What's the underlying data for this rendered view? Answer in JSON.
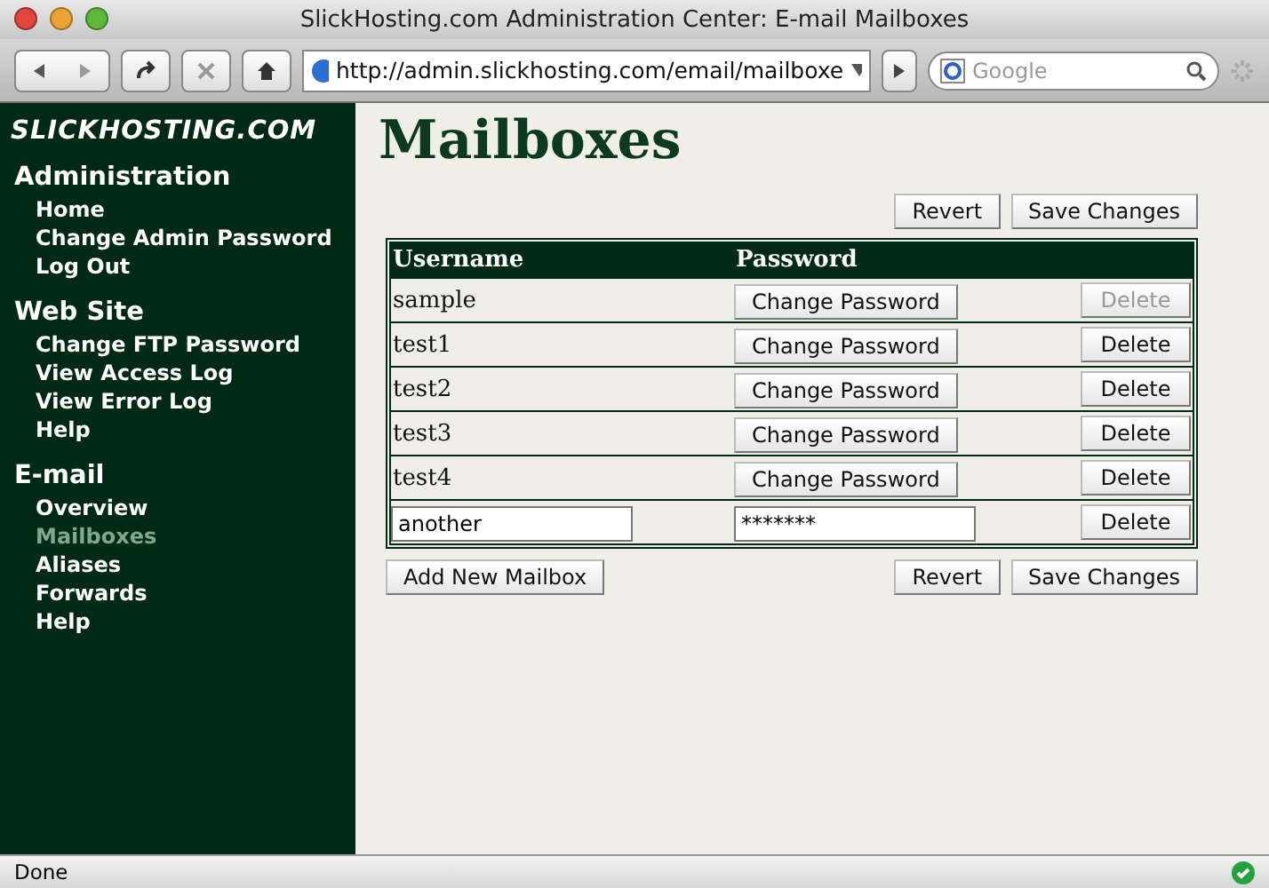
{
  "window": {
    "title": "SlickHosting.com Administration Center: E-mail Mailboxes"
  },
  "address_bar": {
    "url": "http://admin.slickhosting.com/email/mailboxe"
  },
  "search": {
    "placeholder": "Google"
  },
  "sidebar": {
    "logo": "SLICKHOSTING.COM",
    "sections": [
      {
        "title": "Administration",
        "items": [
          {
            "label": "Home",
            "selected": false
          },
          {
            "label": "Change Admin Password",
            "selected": false
          },
          {
            "label": "Log Out",
            "selected": false
          }
        ]
      },
      {
        "title": "Web Site",
        "items": [
          {
            "label": "Change FTP Password",
            "selected": false
          },
          {
            "label": "View Access Log",
            "selected": false
          },
          {
            "label": "View Error Log",
            "selected": false
          },
          {
            "label": "Help",
            "selected": false
          }
        ]
      },
      {
        "title": "E-mail",
        "items": [
          {
            "label": "Overview",
            "selected": false
          },
          {
            "label": "Mailboxes",
            "selected": true
          },
          {
            "label": "Aliases",
            "selected": false
          },
          {
            "label": "Forwards",
            "selected": false
          },
          {
            "label": "Help",
            "selected": false
          }
        ]
      }
    ]
  },
  "page": {
    "heading": "Mailboxes",
    "top_buttons": {
      "revert": "Revert",
      "save": "Save Changes"
    },
    "bottom_buttons": {
      "add": "Add New Mailbox",
      "revert": "Revert",
      "save": "Save Changes"
    }
  },
  "table": {
    "columns": [
      "Username",
      "Password"
    ],
    "rows": [
      {
        "kind": "text",
        "username": "sample",
        "action": "Change Password",
        "delete": "Delete",
        "delete_disabled": true
      },
      {
        "kind": "text",
        "username": "test1",
        "action": "Change Password",
        "delete": "Delete",
        "delete_disabled": false
      },
      {
        "kind": "text",
        "username": "test2",
        "action": "Change Password",
        "delete": "Delete",
        "delete_disabled": false
      },
      {
        "kind": "text",
        "username": "test3",
        "action": "Change Password",
        "delete": "Delete",
        "delete_disabled": false
      },
      {
        "kind": "text",
        "username": "test4",
        "action": "Change Password",
        "delete": "Delete",
        "delete_disabled": false
      },
      {
        "kind": "edit",
        "username": "another",
        "password": "*******",
        "delete": "Delete",
        "delete_disabled": false
      }
    ]
  },
  "status_bar": {
    "text": "Done"
  }
}
